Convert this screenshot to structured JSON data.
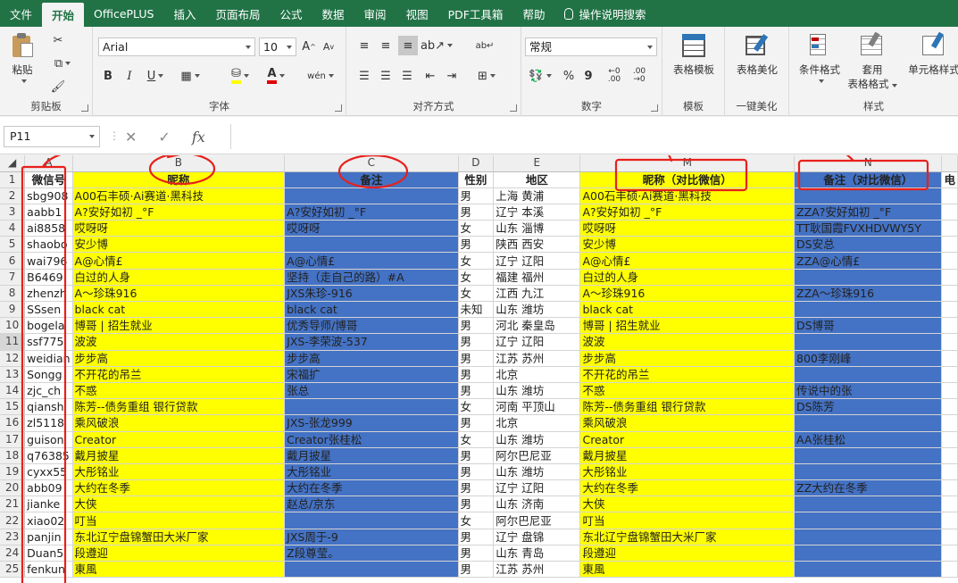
{
  "ribbon_tabs": [
    "文件",
    "开始",
    "OfficePLUS",
    "插入",
    "页面布局",
    "公式",
    "数据",
    "审阅",
    "视图",
    "PDF工具箱",
    "帮助"
  ],
  "tell_me": "操作说明搜索",
  "clipboard": {
    "paste": "粘贴",
    "label": "剪贴板"
  },
  "font": {
    "name": "Arial",
    "size": "10",
    "grow": "A",
    "shrink": "A",
    "bold": "B",
    "italic": "I",
    "underline": "U",
    "phonetic": "wén",
    "label": "字体"
  },
  "alignment": {
    "label": "对齐方式"
  },
  "number": {
    "format": "常规",
    "percent": "%",
    "comma": "9",
    "label": "数字"
  },
  "template": {
    "btn": "表格模板",
    "label": "模板"
  },
  "beautify": {
    "btn": "表格美化",
    "label": "一键美化"
  },
  "styles": {
    "cond": "条件格式",
    "apply": "套用",
    "apply2": "表格格式",
    "cell": "单元格样式",
    "label": "样式"
  },
  "namebox": "P11",
  "fx": "fx",
  "columns": [
    "A",
    "B",
    "C",
    "D",
    "E",
    "M",
    "N"
  ],
  "rows": [
    {
      "n": "1",
      "a": "微信号",
      "b": "昵称",
      "c": "备注",
      "d": "性别",
      "e": "地区",
      "m": "昵称（对比微信）",
      "nn": "备注（对比微信）",
      "extra": "电"
    },
    {
      "n": "2",
      "a": "sbg908",
      "b": "A00石丰硕·Ai赛道·黑科技",
      "c": "",
      "d": "男",
      "e": "上海 黄浦",
      "m": "A00石丰硕·Ai赛道·黑科技",
      "nn": ""
    },
    {
      "n": "3",
      "a": "aabb1",
      "b": "A?安好如初 _°F",
      "c": "A?安好如初 _°F",
      "d": "男",
      "e": "辽宁 本溪",
      "m": "A?安好如初 _°F",
      "nn": "ZZA?安好如初 _°F"
    },
    {
      "n": "4",
      "a": "ai8858",
      "b": "哎呀呀",
      "c": "哎呀呀",
      "d": "女",
      "e": "山东 淄博",
      "m": "哎呀呀",
      "nn": "TT耿国霞FVXHDVWY5Y"
    },
    {
      "n": "5",
      "a": "shaobo",
      "b": "安少博",
      "c": "",
      "d": "男",
      "e": "陕西 西安",
      "m": "安少博",
      "nn": "DS安总"
    },
    {
      "n": "6",
      "a": "wai796",
      "b": "A@心情£",
      "c": "A@心情£",
      "d": "女",
      "e": "辽宁 辽阳",
      "m": "A@心情£",
      "nn": "ZZA@心情£"
    },
    {
      "n": "7",
      "a": "B6469",
      "b": "白过的人身",
      "c": "坚持（走自己的路）#A",
      "d": "女",
      "e": "福建 福州",
      "m": "白过的人身",
      "nn": ""
    },
    {
      "n": "8",
      "a": "zhenzh",
      "b": "A～珍珠916",
      "c": "JXS朱珍-916",
      "d": "女",
      "e": "江西 九江",
      "m": "A～珍珠916",
      "nn": "ZZA～珍珠916"
    },
    {
      "n": "9",
      "a": "SSsen",
      "b": "black cat",
      "c": "black cat",
      "d": "未知",
      "e": "山东 潍坊",
      "m": "black cat",
      "nn": ""
    },
    {
      "n": "10",
      "a": "bogela",
      "b": "博哥 | 招生就业",
      "c": "优秀导师/博哥",
      "d": "男",
      "e": "河北 秦皇岛",
      "m": "博哥 | 招生就业",
      "nn": "DS博哥"
    },
    {
      "n": "11",
      "a": "ssf775",
      "b": "波波",
      "c": "JXS-李荣波-537",
      "d": "男",
      "e": "辽宁 辽阳",
      "m": "波波",
      "nn": ""
    },
    {
      "n": "12",
      "a": "weidian",
      "b": "步步高",
      "c": "步步高",
      "d": "男",
      "e": "江苏 苏州",
      "m": "步步高",
      "nn": "800李刚峰"
    },
    {
      "n": "13",
      "a": "Songg",
      "b": "不开花的吊兰",
      "c": "宋福扩",
      "d": "男",
      "e": "北京",
      "m": "不开花的吊兰",
      "nn": ""
    },
    {
      "n": "14",
      "a": "zjc_ch",
      "b": "不惑",
      "c": "张总",
      "d": "男",
      "e": "山东 潍坊",
      "m": "不惑",
      "nn": "传说中的张"
    },
    {
      "n": "15",
      "a": "qiansh",
      "b": "陈芳--债务重组 银行贷款",
      "c": "",
      "d": "女",
      "e": "河南 平顶山",
      "m": "陈芳--债务重组 银行贷款",
      "nn": "DS陈芳"
    },
    {
      "n": "16",
      "a": "zl5118",
      "b": "乘风破浪",
      "c": "JXS-张龙999",
      "d": "男",
      "e": "北京",
      "m": "乘风破浪",
      "nn": ""
    },
    {
      "n": "17",
      "a": "guison",
      "b": "Creator",
      "c": "Creator张桂松",
      "d": "女",
      "e": "山东 潍坊",
      "m": "Creator",
      "nn": "AA张桂松"
    },
    {
      "n": "18",
      "a": "q76385",
      "b": "戴月披星",
      "c": "戴月披星",
      "d": "男",
      "e": "阿尔巴尼亚",
      "m": "戴月披星",
      "nn": ""
    },
    {
      "n": "19",
      "a": "cyxx55",
      "b": "大彤铭业",
      "c": "大彤铭业",
      "d": "男",
      "e": "山东 潍坊",
      "m": "大彤铭业",
      "nn": ""
    },
    {
      "n": "20",
      "a": "abb09",
      "b": "大约在冬季",
      "c": "大约在冬季",
      "d": "男",
      "e": "辽宁 辽阳",
      "m": "大约在冬季",
      "nn": "ZZ大约在冬季"
    },
    {
      "n": "21",
      "a": "jianke",
      "b": "大侠",
      "c": "赵总/京东",
      "d": "男",
      "e": "山东 济南",
      "m": "大侠",
      "nn": ""
    },
    {
      "n": "22",
      "a": "xiao02",
      "b": "叮当",
      "c": "",
      "d": "女",
      "e": "阿尔巴尼亚",
      "m": "叮当",
      "nn": ""
    },
    {
      "n": "23",
      "a": "panjin",
      "b": "东北辽宁盘锦蟹田大米厂家",
      "c": "JXS周于-9",
      "d": "男",
      "e": "辽宁 盘锦",
      "m": "东北辽宁盘锦蟹田大米厂家",
      "nn": ""
    },
    {
      "n": "24",
      "a": "Duan5",
      "b": "段遵迎",
      "c": "Z段尊莹。",
      "d": "男",
      "e": "山东 青岛",
      "m": "段遵迎",
      "nn": ""
    },
    {
      "n": "25",
      "a": "fenkun",
      "b": "東風",
      "c": "",
      "d": "男",
      "e": "江苏 苏州",
      "m": "東風",
      "nn": ""
    }
  ]
}
